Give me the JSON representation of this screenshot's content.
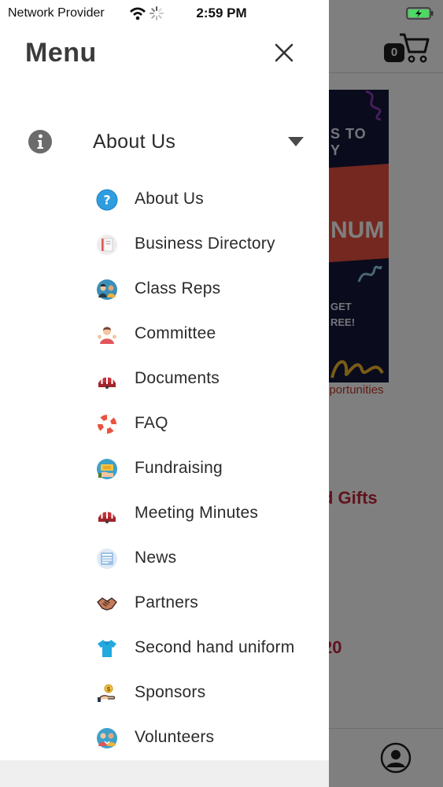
{
  "status_bar": {
    "carrier": "Network Provider",
    "time": "2:59 PM"
  },
  "background": {
    "cart_count": "0",
    "promo": {
      "line1": "S TO",
      "line1b": "Y",
      "line2": "NUM",
      "line3a": "GET",
      "line3b": "REE!"
    },
    "link_text": "pportunities",
    "heading_text": "d Gifts",
    "year_text": "20"
  },
  "drawer": {
    "title": "Menu",
    "close_icon": "close-icon",
    "section": {
      "label": "About Us",
      "icon": "info-icon",
      "expanded": true
    },
    "items": [
      {
        "label": "About Us",
        "icon": "question-icon"
      },
      {
        "label": "Business Directory",
        "icon": "directory-icon"
      },
      {
        "label": "Class Reps",
        "icon": "class-reps-icon"
      },
      {
        "label": "Committee",
        "icon": "committee-icon"
      },
      {
        "label": "Documents",
        "icon": "documents-icon"
      },
      {
        "label": "FAQ",
        "icon": "lifebuoy-icon"
      },
      {
        "label": "Fundraising",
        "icon": "fundraising-icon"
      },
      {
        "label": "Meeting Minutes",
        "icon": "meeting-minutes-icon"
      },
      {
        "label": "News",
        "icon": "news-icon"
      },
      {
        "label": "Partners",
        "icon": "handshake-icon"
      },
      {
        "label": "Second hand uniform",
        "icon": "shirt-icon"
      },
      {
        "label": "Sponsors",
        "icon": "sponsor-hand-icon"
      },
      {
        "label": "Volunteers",
        "icon": "volunteers-icon"
      }
    ]
  },
  "colors": {
    "accent_red": "#c0263a",
    "menu_text": "#2b2b2b",
    "overlay": "rgba(0,0,0,0.5)"
  }
}
